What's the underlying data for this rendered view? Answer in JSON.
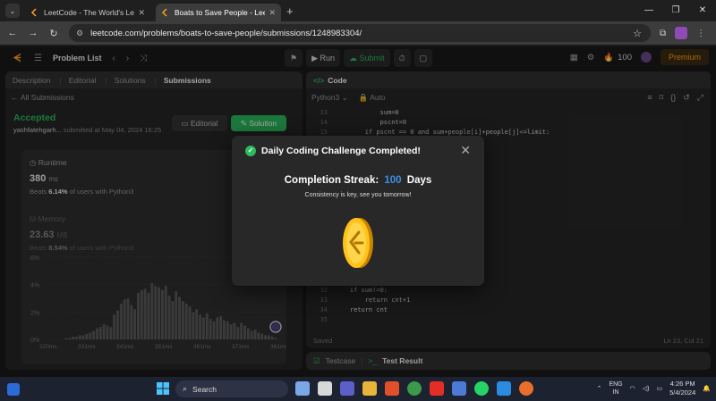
{
  "browser": {
    "tabs": [
      {
        "title": "LeetCode - The World's Leading",
        "active": false
      },
      {
        "title": "Boats to Save People - LeetCod",
        "active": true
      }
    ],
    "url": "leetcode.com/problems/boats-to-save-people/submissions/1248983304/"
  },
  "nav": {
    "problem_list": "Problem List",
    "run": "Run",
    "submit": "Submit",
    "streak_count": "100",
    "premium": "Premium"
  },
  "left": {
    "tabs": [
      "Description",
      "Editorial",
      "Solutions",
      "Submissions"
    ],
    "all_submissions": "All Submissions",
    "status": "Accepted",
    "user": "yashfatehgarh...",
    "submitted_at": "submitted at May 04, 2024 16:25",
    "editorial_btn": "Editorial",
    "solution_btn": "Solution",
    "runtime": {
      "label": "Runtime",
      "value": "380",
      "unit": "ms",
      "beats_prefix": "Beats",
      "beats": "6.14%",
      "beats_suffix": "of users with Python3"
    },
    "memory": {
      "label": "Memory",
      "value": "23.63",
      "unit": "MB",
      "beats_prefix": "Beats",
      "beats": "8.54%",
      "beats_suffix": "of users with Python3"
    }
  },
  "chart_data": {
    "type": "bar",
    "yticks": [
      "6%",
      "4%",
      "2%",
      "0%"
    ],
    "ylim": [
      0,
      6
    ],
    "xticks": [
      "320ms",
      "331ms",
      "341ms",
      "351ms",
      "361ms",
      "371ms",
      "381ms"
    ],
    "values": [
      0.1,
      0.1,
      0.2,
      0.2,
      0.3,
      0.3,
      0.4,
      0.5,
      0.6,
      0.8,
      0.9,
      1.1,
      1.0,
      0.9,
      1.8,
      2.1,
      2.6,
      2.9,
      3.0,
      2.5,
      2.2,
      3.4,
      3.6,
      3.7,
      3.4,
      4.1,
      3.9,
      3.8,
      3.6,
      3.9,
      3.2,
      2.8,
      3.5,
      3.1,
      2.8,
      2.6,
      2.4,
      2.0,
      2.2,
      1.8,
      1.6,
      1.9,
      1.5,
      1.3,
      1.6,
      1.7,
      1.4,
      1.3,
      1.1,
      1.2,
      0.9,
      1.2,
      1.0,
      0.8,
      0.6,
      0.7,
      0.5,
      0.4,
      0.3,
      0.3,
      0.2,
      0.1
    ],
    "marker_x": "381ms"
  },
  "code": {
    "header": "Code",
    "language": "Python3",
    "mode": "Auto",
    "lines": [
      {
        "n": "13",
        "t": "            sum=0"
      },
      {
        "n": "14",
        "t": "            pscnt=0"
      },
      {
        "n": "15",
        "t": "        if pscnt == 0 and sum+people[i]+people[j]<=limit:"
      },
      {
        "n": "32",
        "t": "    if sum!=0:"
      },
      {
        "n": "33",
        "t": "        return cnt+1"
      },
      {
        "n": "34",
        "t": "    return cnt"
      },
      {
        "n": "35",
        "t": ""
      }
    ],
    "saved": "Saved",
    "position": "Ln 23, Col 21"
  },
  "test": {
    "testcase": "Testcase",
    "result": "Test Result"
  },
  "modal": {
    "title": "Daily Coding Challenge Completed!",
    "streak_prefix": "Completion Streak:",
    "streak_value": "100",
    "streak_suffix": "Days",
    "message": "Consistency is key, see you tomorrow!"
  },
  "taskbar": {
    "search": "Search",
    "lang1": "ENG",
    "lang2": "IN",
    "time": "4:26 PM",
    "date": "5/4/2024"
  },
  "colors": {
    "accent_green": "#2cbb5d",
    "accent_orange": "#ffa116",
    "streak_blue": "#3e8fe6"
  }
}
